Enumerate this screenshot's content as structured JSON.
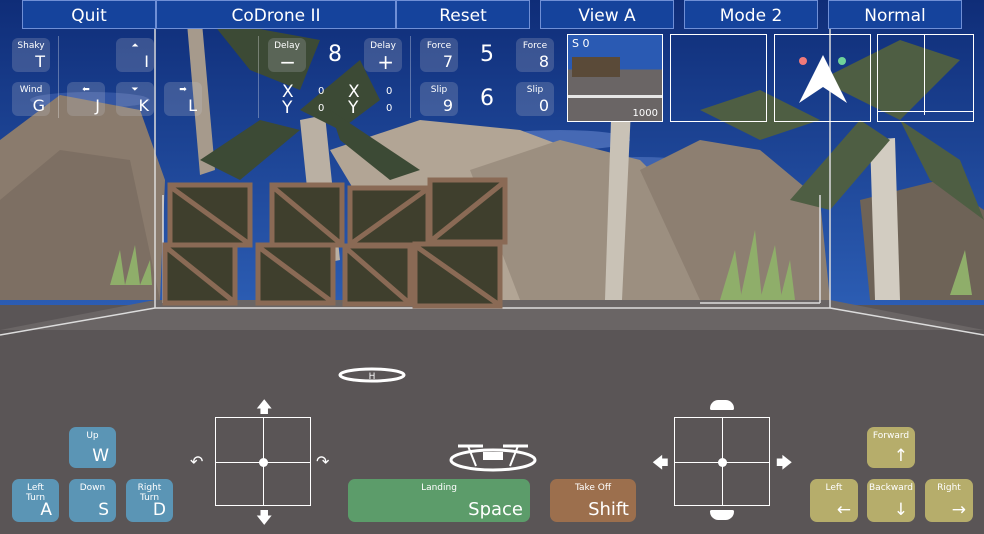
{
  "top_bar": {
    "quit": "Quit",
    "title": "CoDrone II",
    "reset": "Reset",
    "view": "View A",
    "mode": "Mode 2",
    "speed": "Normal"
  },
  "keys": {
    "shaky": {
      "label": "Shaky",
      "key": "T"
    },
    "throttle_up": {
      "key": "I"
    },
    "wind": {
      "label": "Wind",
      "key": "G"
    },
    "left": {
      "key": "J"
    },
    "down": {
      "key": "K"
    },
    "right": {
      "key": "L"
    },
    "delay_minus": {
      "label": "Delay",
      "key": "−"
    },
    "delay_plus": {
      "label": "Delay",
      "key": "+"
    },
    "force_minus": {
      "label": "Force",
      "key": "7"
    },
    "force_plus": {
      "label": "Force",
      "key": "8"
    },
    "slip_minus": {
      "label": "Slip",
      "key": "9"
    },
    "slip_plus": {
      "label": "Slip",
      "key": "0"
    }
  },
  "values": {
    "delay": "8",
    "force": "5",
    "slip": "6",
    "x1_label": "X",
    "x1_value": "0",
    "y1_label": "Y",
    "y1_value": "0",
    "x2_label": "X",
    "x2_value": "0",
    "y2_label": "Y",
    "y2_value": "0"
  },
  "minimap": {
    "label": "S 0",
    "altitude": "1000"
  },
  "bottom_keys": {
    "up": {
      "label": "Up",
      "key": "W"
    },
    "left_turn": {
      "label": "Left Turn",
      "key": "A"
    },
    "down": {
      "label": "Down",
      "key": "S"
    },
    "right_turn": {
      "label": "Right Turn",
      "key": "D"
    },
    "landing": {
      "label": "Landing",
      "key": "Space"
    },
    "take_off": {
      "label": "Take Off",
      "key": "Shift"
    },
    "forward": {
      "label": "Forward",
      "key": "↑"
    },
    "left": {
      "label": "Left",
      "key": "←"
    },
    "backward": {
      "label": "Backward",
      "key": "↓"
    },
    "right": {
      "label": "Right",
      "key": "→"
    }
  },
  "colors": {
    "top_bar": "#15439c",
    "sky": "#1b3f8f",
    "ground": "#5a5556",
    "landing": "#5c9c6a",
    "take_off": "#9c6f4d",
    "blue_key": "#5b95b5",
    "olive_key": "#b6ad6b"
  }
}
